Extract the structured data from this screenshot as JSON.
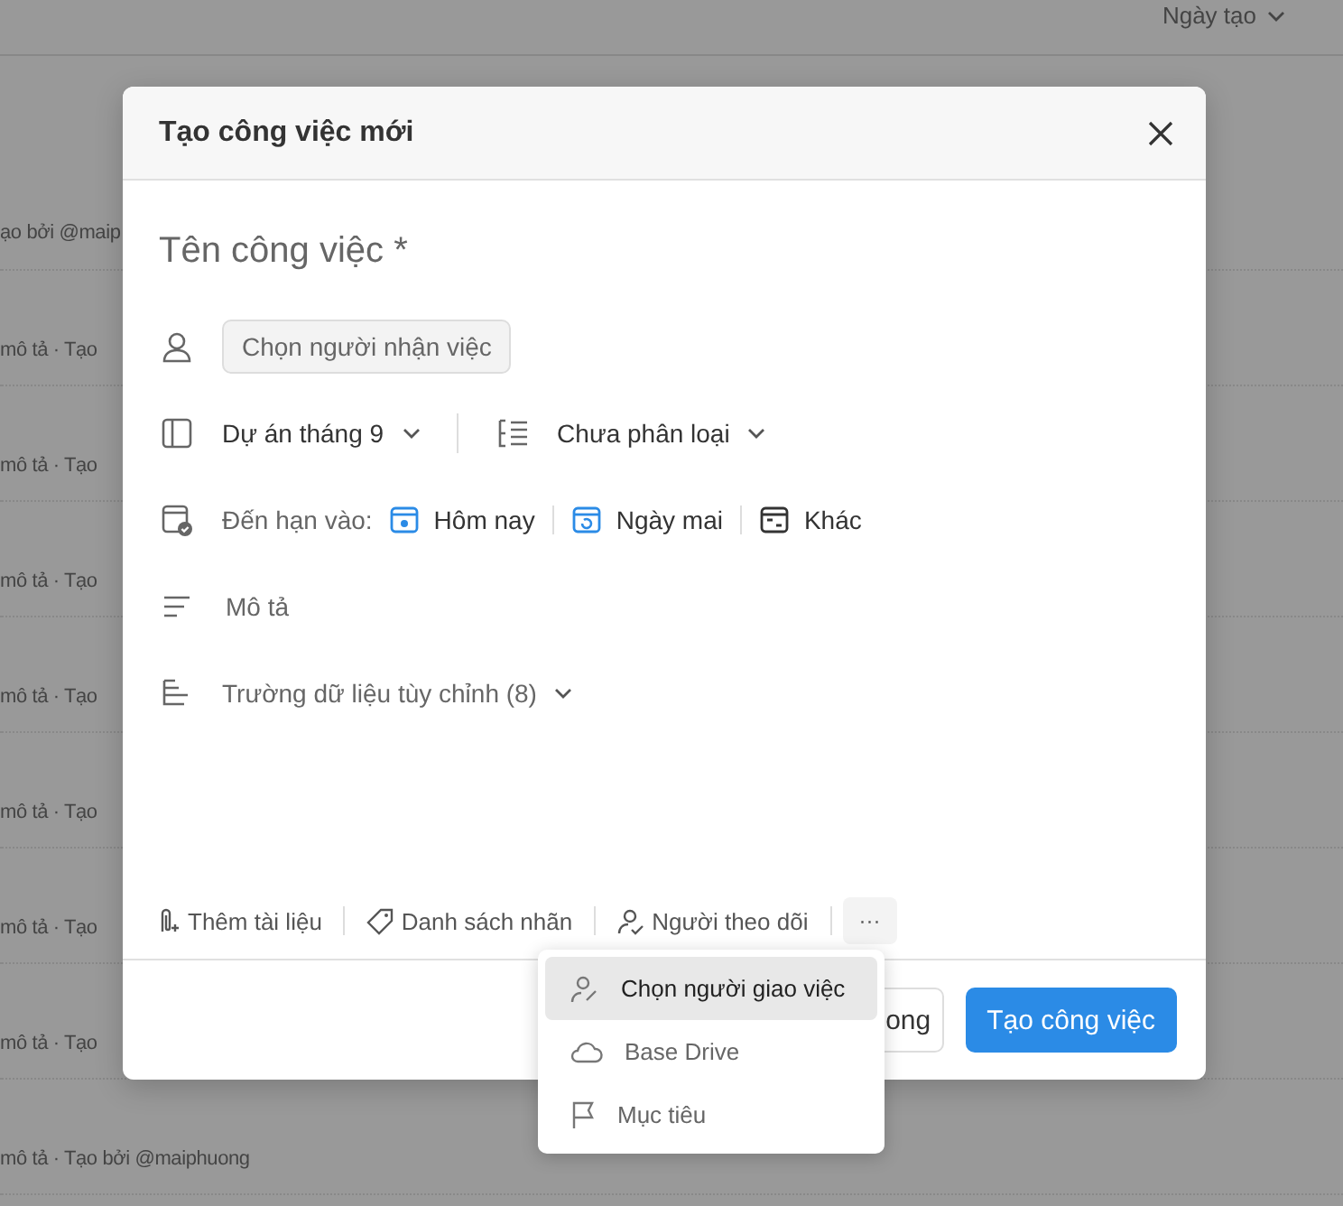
{
  "background": {
    "sort_label": "Ngày tạo",
    "rows": [
      "ạo bởi @maip",
      "mô tả · Tạo",
      "mô tả · Tạo",
      "mô tả · Tạo",
      "mô tả · Tạo",
      "mô tả · Tạo",
      "mô tả · Tạo",
      "mô tả · Tạo",
      "mô tả · Tạo bởi @maiphuong"
    ]
  },
  "dialog": {
    "title": "Tạo công việc mới",
    "name_placeholder": "Tên công việc *",
    "assignee_placeholder": "Chọn người nhận việc",
    "project": "Dự án tháng 9",
    "category": "Chưa phân loại",
    "due_label": "Đến hạn vào:",
    "due_options": [
      {
        "kind": "today",
        "label": "Hôm nay"
      },
      {
        "kind": "tomorrow",
        "label": "Ngày mai"
      },
      {
        "kind": "other",
        "label": "Khác"
      }
    ],
    "description_placeholder": "Mô tả",
    "custom_fields": "Trường dữ liệu tùy chỉnh (8)",
    "toolbar": [
      {
        "kind": "attach",
        "label": "Thêm tài liệu"
      },
      {
        "kind": "tag",
        "label": "Danh sách nhãn"
      },
      {
        "kind": "followers",
        "label": "Người theo dõi"
      }
    ],
    "more_label": "···",
    "cancel_label": "ong",
    "submit_label": "Tạo công việc"
  },
  "menu": [
    {
      "kind": "assigner",
      "label": "Chọn người giao việc",
      "selected": true
    },
    {
      "kind": "drive",
      "label": "Base Drive",
      "selected": false
    },
    {
      "kind": "goal",
      "label": "Mục tiêu",
      "selected": false
    }
  ]
}
